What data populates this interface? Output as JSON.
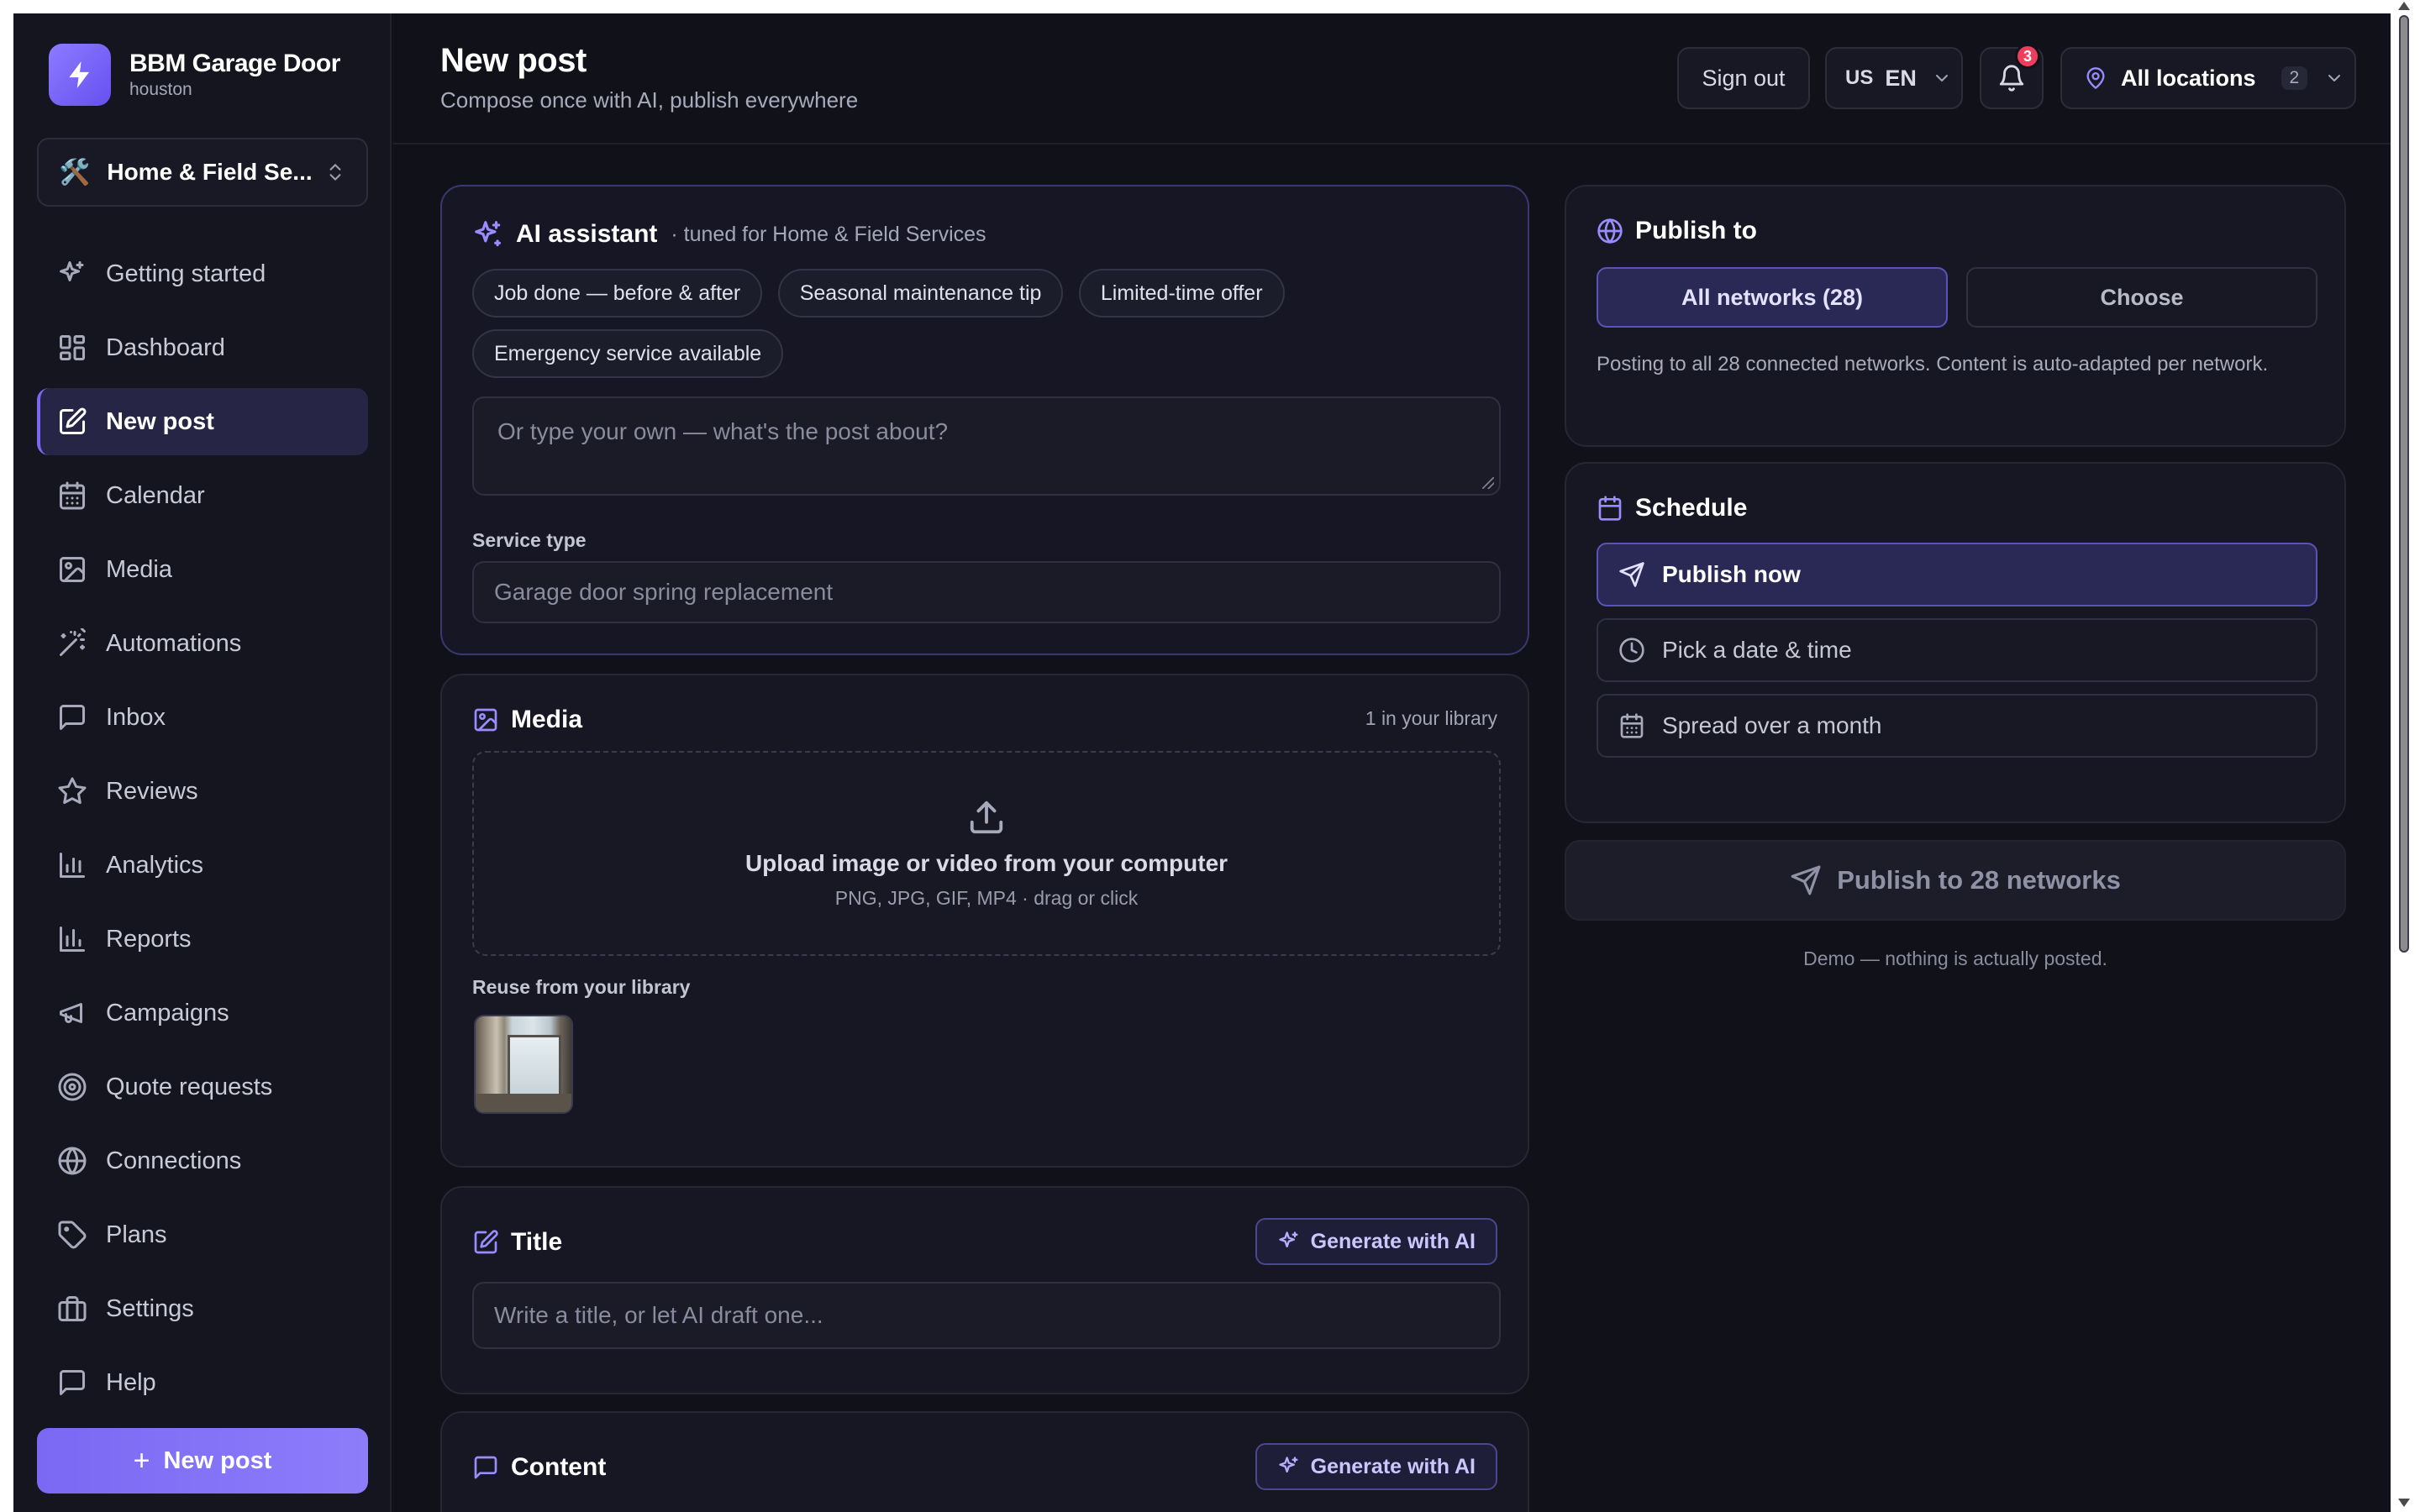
{
  "colors": {
    "accent": "#7b68f3",
    "background": "#101119",
    "badge": "#ef3e5c"
  },
  "brand": {
    "name": "BBM Garage Door",
    "location": "houston",
    "icon": "bolt-icon"
  },
  "workspace": {
    "icon": "🛠️",
    "label": "Home & Field Se..."
  },
  "sidebar": {
    "items": [
      {
        "label": "Getting started",
        "icon": "sparkle-icon"
      },
      {
        "label": "Dashboard",
        "icon": "grid-icon"
      },
      {
        "label": "New post",
        "icon": "edit-icon",
        "active": true
      },
      {
        "label": "Calendar",
        "icon": "calendar-icon"
      },
      {
        "label": "Media",
        "icon": "image-icon"
      },
      {
        "label": "Automations",
        "icon": "wand-icon"
      },
      {
        "label": "Inbox",
        "icon": "message-icon"
      },
      {
        "label": "Reviews",
        "icon": "star-icon"
      },
      {
        "label": "Analytics",
        "icon": "bar-chart-icon"
      },
      {
        "label": "Reports",
        "icon": "bar-chart-icon"
      },
      {
        "label": "Campaigns",
        "icon": "megaphone-icon"
      },
      {
        "label": "Quote requests",
        "icon": "target-icon"
      },
      {
        "label": "Connections",
        "icon": "globe-icon"
      },
      {
        "label": "Plans",
        "icon": "tag-icon"
      },
      {
        "label": "Settings",
        "icon": "briefcase-icon"
      },
      {
        "label": "Help",
        "icon": "message-icon"
      }
    ],
    "new_post_label": "New post"
  },
  "header": {
    "title": "New post",
    "subtitle": "Compose once with AI, publish everywhere",
    "sign_out": "Sign out",
    "lang_flag": "US",
    "lang_code": "EN",
    "notification_count": "3",
    "locations_label": "All locations",
    "locations_count": "2"
  },
  "ai": {
    "title": "AI assistant",
    "tuned": "· tuned for Home & Field Services",
    "chips": [
      "Job done — before & after",
      "Seasonal maintenance tip",
      "Limited-time offer",
      "Emergency service available"
    ],
    "prompt_placeholder": "Or type your own — what's the post about?",
    "service_label": "Service type",
    "service_placeholder": "Garage door spring replacement"
  },
  "media": {
    "title": "Media",
    "library_count": "1 in your library",
    "upload_title": "Upload image or video from your computer",
    "upload_sub": "PNG, JPG, GIF, MP4 · drag or click",
    "reuse_label": "Reuse from your library"
  },
  "title_section": {
    "title": "Title",
    "generate": "Generate with AI",
    "placeholder": "Write a title, or let AI draft one..."
  },
  "content_section": {
    "title": "Content",
    "generate": "Generate with AI"
  },
  "publish": {
    "title": "Publish to",
    "all_networks": "All networks (28)",
    "choose": "Choose",
    "note": "Posting to all 28 connected networks. Content is auto-adapted per network."
  },
  "schedule": {
    "title": "Schedule",
    "options": [
      "Publish now",
      "Pick a date & time",
      "Spread over a month"
    ],
    "selected": "Publish now"
  },
  "publish_button": "Publish to 28 networks",
  "demo_note": "Demo — nothing is actually posted."
}
